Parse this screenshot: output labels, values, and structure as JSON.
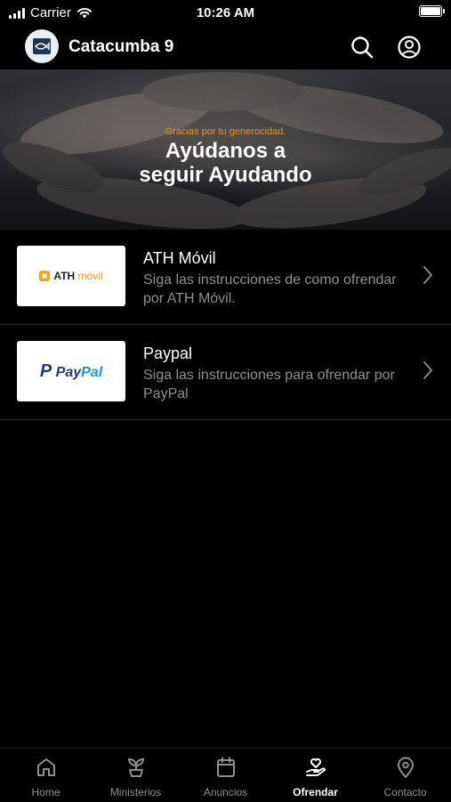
{
  "status_bar": {
    "carrier": "Carrier",
    "time": "10:26 AM"
  },
  "header": {
    "title": "Catacumba 9",
    "icons": [
      "search-icon",
      "account-circle-icon"
    ]
  },
  "banner": {
    "tagline": "Gracias por tu generocidad.",
    "title_line1": "Ayúdanos a",
    "title_line2": "seguir Ayudando",
    "tagline_color": "#e8961e"
  },
  "options": [
    {
      "title": "ATH Móvil",
      "description": "Siga las instrucciones de como ofrendar por ATH Móvil.",
      "logo": {
        "prefix": "ATH",
        "suffix": "móvil"
      }
    },
    {
      "title": "Paypal",
      "description": "Siga las instrucciones para ofrendar por PayPal",
      "logo": {
        "prefix": "Pay",
        "suffix": "Pal"
      }
    }
  ],
  "tabs": [
    {
      "label": "Home",
      "icon": "home-icon"
    },
    {
      "label": "Ministerios",
      "icon": "plant-icon"
    },
    {
      "label": "Anuncios",
      "icon": "calendar-icon"
    },
    {
      "label": "Ofrendar",
      "icon": "giving-hand-icon",
      "active": true
    },
    {
      "label": "Contacto",
      "icon": "location-pin-icon"
    }
  ],
  "colors": {
    "background": "#000000",
    "secondary_text": "#8e8e93",
    "ath_orange": "#f4a11a",
    "paypal_dark": "#253b80",
    "paypal_light": "#179bd7"
  }
}
